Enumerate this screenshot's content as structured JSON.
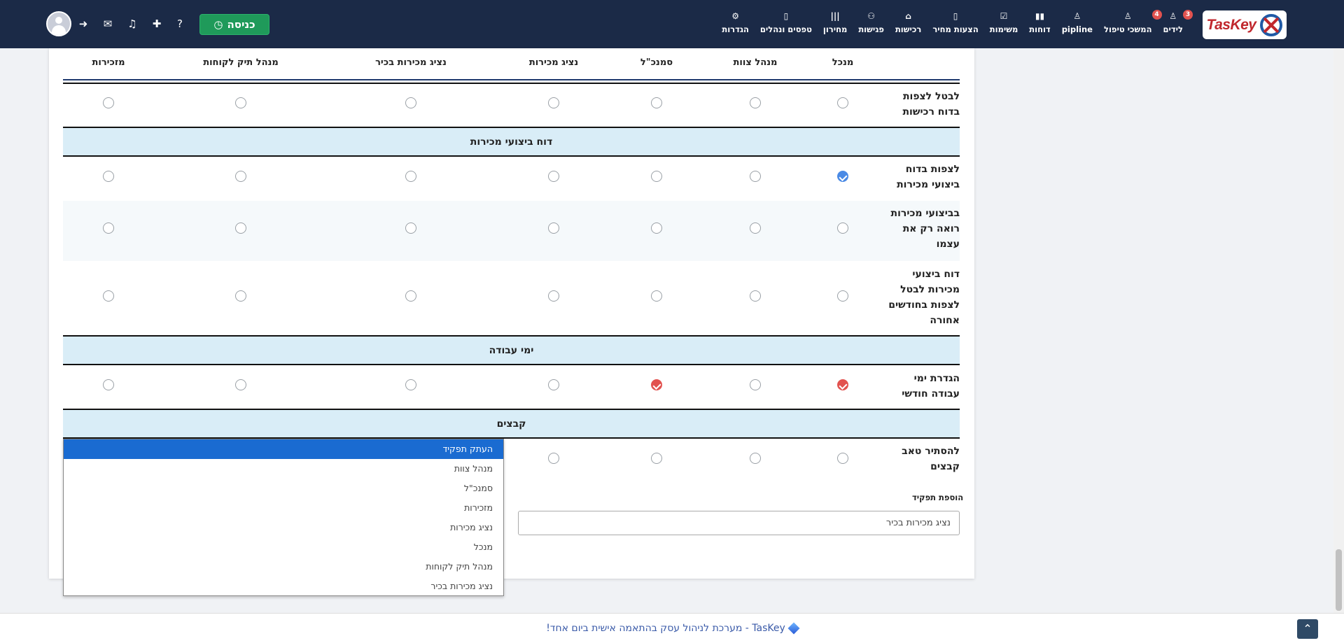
{
  "brand": {
    "logo_text": "TasKey"
  },
  "nav": {
    "items": [
      {
        "label": "לידים",
        "icon": "user-badge-icon",
        "badge": "3"
      },
      {
        "label": "המשכי טיפול",
        "icon": "user-badge-icon",
        "badge": "4"
      },
      {
        "label": "pipline",
        "icon": "user-badge-icon",
        "badge": ""
      },
      {
        "label": "דוחות",
        "icon": "bar-chart-icon",
        "badge": ""
      },
      {
        "label": "משימות",
        "icon": "checkbox-icon",
        "badge": ""
      },
      {
        "label": "הצעות מחיר",
        "icon": "document-icon",
        "badge": ""
      },
      {
        "label": "רכישות",
        "icon": "shop-icon",
        "badge": ""
      },
      {
        "label": "פגישות",
        "icon": "handshake-icon",
        "badge": ""
      },
      {
        "label": "מחירון",
        "icon": "barcode-icon",
        "badge": ""
      },
      {
        "label": "טפסים ונהלים",
        "icon": "book-icon",
        "badge": ""
      },
      {
        "label": "הגדרות",
        "icon": "gear-icon",
        "badge": ""
      }
    ],
    "enter_button": "כניסה"
  },
  "columns": [
    "מנכל",
    "מנהל צוות",
    "סמנכ\"ל",
    "נציג מכירות",
    "נציג מכירות בכיר",
    "מנהל תיק לקוחות",
    "מזכירות"
  ],
  "rows": {
    "cancel_purchase_report": "לבטל לצפות בדוח רכישות",
    "view_sales_report": "לצפות בדוח ביצועי מכירות",
    "sales_sees_self": "בביצועי מכירות רואה רק את עצמו",
    "sales_report_cancel_past": "דוח ביצועי מכירות לבטל לצפות בחודשים אחורה",
    "monthly_workdays": "הגדרת ימי עבודה חודשי",
    "hide_files_tab": "להסתיר טאב קבצים"
  },
  "sections": {
    "sales_report": "דוח ביצועי מכירות",
    "work_days": "ימי עבודה",
    "files": "קבצים"
  },
  "add_role": {
    "label": "הוספת תפקיד",
    "value": "נציג מכירות בכיר"
  },
  "dropdown": {
    "options": [
      "העתק תפקיד",
      "מנהל צוות",
      "סמנכ\"ל",
      "מזכירות",
      "נציג מכירות",
      "מנכל",
      "מנהל תיק לקוחות",
      "נציג מכירות בכיר"
    ],
    "selected": "העתק תפקיד"
  },
  "footer": {
    "text": "TasKey - מערכת לניהול עסק בהתאמה אישית ביום אחד!"
  },
  "colors": {
    "nav_bg": "#1b2a47",
    "enter_green": "#1f9a5a",
    "section_bg": "#d9edf7",
    "check_blue": "#4a8ae5",
    "check_red": "#e2524f",
    "selected_blue": "#1a6bd1"
  }
}
